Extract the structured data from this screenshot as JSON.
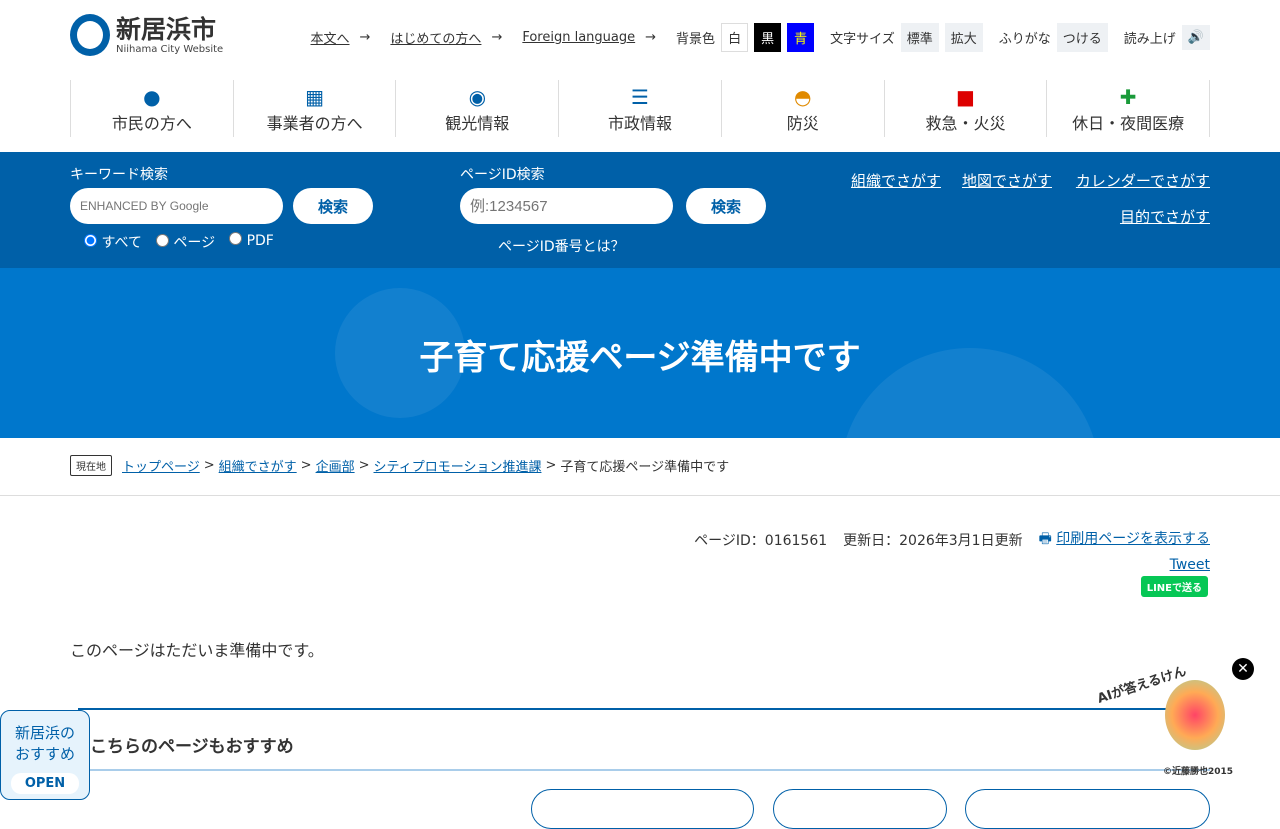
{
  "header": {
    "logo_name": "新居浜市",
    "logo_sub": "Niihama City Website",
    "links": [
      "本文へ",
      "はじめての方へ",
      "Foreign language"
    ],
    "bg_label": "背景色",
    "bg_options": [
      "白",
      "黒",
      "青"
    ],
    "size_label": "文字サイズ",
    "size_options": [
      "標準",
      "拡大"
    ],
    "furigana_label": "ふりがな",
    "furigana_btn": "つける",
    "read_label": "読み上げ"
  },
  "nav": [
    {
      "icon": "person-icon",
      "label": "市民の方へ"
    },
    {
      "icon": "building-icon",
      "label": "事業者の方へ"
    },
    {
      "icon": "map-pin-icon",
      "label": "観光情報"
    },
    {
      "icon": "list-icon",
      "label": "市政情報"
    },
    {
      "icon": "helmet-icon",
      "label": "防災"
    },
    {
      "icon": "ambulance-icon",
      "label": "救急・火災"
    },
    {
      "icon": "first-aid-icon",
      "label": "休日・夜間医療"
    }
  ],
  "search": {
    "keyword_label": "キーワード検索",
    "keyword_placeholder": "ENHANCED BY Google",
    "button": "検索",
    "scopes": [
      "すべて",
      "ページ",
      "PDF"
    ],
    "pageid_label": "ページID検索",
    "pageid_placeholder": "例:1234567",
    "pageid_help": "ページID番号とは？",
    "links": [
      "組織でさがす",
      "地図でさがす",
      "カレンダーでさがす",
      "目的でさがす"
    ]
  },
  "hero": {
    "title": "子育て応援ページ準備中です"
  },
  "breadcrumb": {
    "here": "現在地",
    "items": [
      "トップページ",
      "組織でさがす",
      "企画部",
      "シティプロモーション推進課"
    ],
    "current": "子育て応援ページ準備中です"
  },
  "meta": {
    "page_id": "ページID：0161561",
    "updated": "更新日：2026年3月1日更新",
    "print": "印刷用ページを表示する",
    "tweet": "Tweet",
    "line": "LINEで送る"
  },
  "content": {
    "text": "このページはただいま準備中です。",
    "rec_title": "こちらのページもおすすめ"
  },
  "float": {
    "osusume": [
      "新居浜の",
      "おすすめ"
    ],
    "open": "OPEN",
    "ai": "AIが答えるけん",
    "credit": "©近藤勝也2015"
  }
}
